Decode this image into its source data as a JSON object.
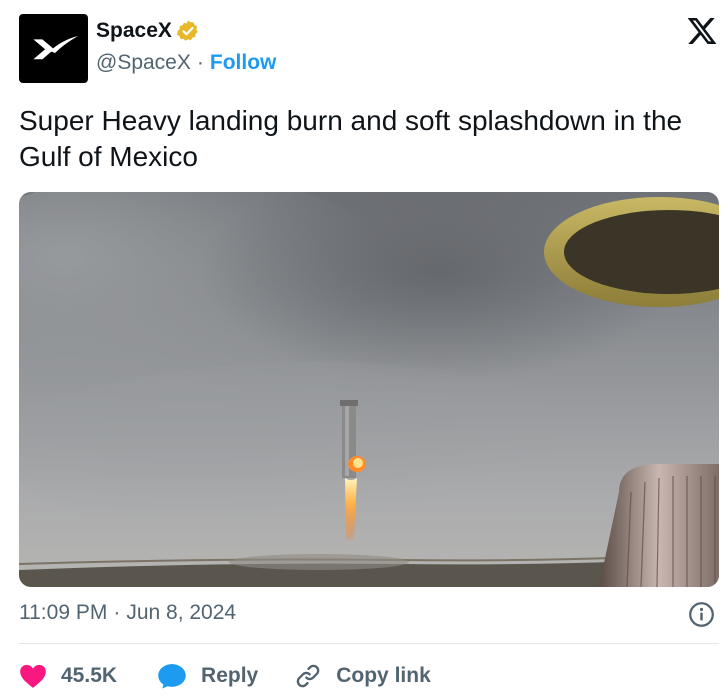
{
  "author": {
    "display_name": "SpaceX",
    "handle": "@SpaceX",
    "separator": "·",
    "follow_label": "Follow",
    "verified_color": "#e8b829",
    "avatar_icon": "spacex-logo-icon"
  },
  "brand_icon": "x-logo-icon",
  "tweet": {
    "text": "Super Heavy landing burn and soft splashdown in the Gulf of Mexico"
  },
  "media": {
    "type": "video-still",
    "description_icon": "rocket-landing-image"
  },
  "meta": {
    "time": "11:09 PM",
    "separator": "·",
    "date": "Jun 8, 2024"
  },
  "actions": {
    "likes": "45.5K",
    "reply_label": "Reply",
    "copy_link_label": "Copy link"
  },
  "colors": {
    "accent": "#1d9bf0",
    "like": "#f91880",
    "muted": "#536471",
    "text": "#0f1419"
  }
}
